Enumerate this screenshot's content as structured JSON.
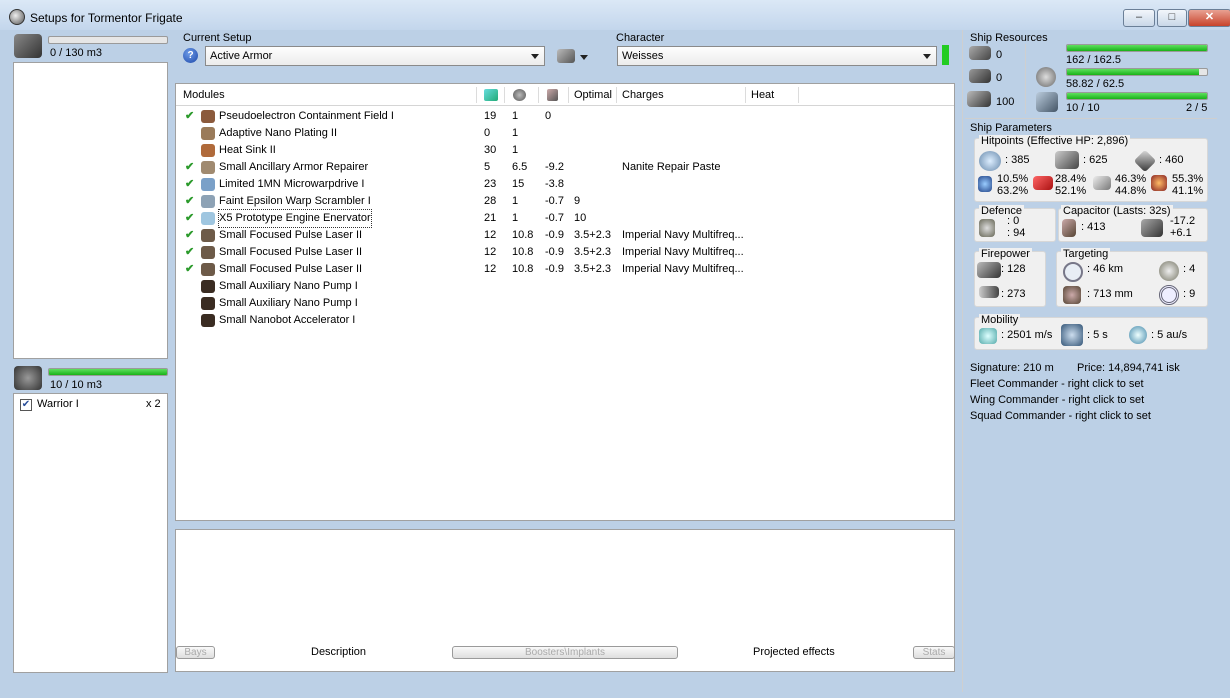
{
  "window": {
    "title": "Setups for Tormentor Frigate",
    "minimize": "–",
    "maximize": "□",
    "close": "✕"
  },
  "cargo": {
    "capacity": "0 / 130 m3",
    "fill": 0
  },
  "drones": {
    "capacity": "10 / 10 m3",
    "fill": 1.0,
    "items": [
      {
        "name": "Warrior I",
        "count": "x 2",
        "checked": true
      }
    ]
  },
  "setup": {
    "label": "Current Setup",
    "value": "Active Armor",
    "help_icon": "question-icon"
  },
  "character": {
    "label": "Character",
    "value": "Weisses"
  },
  "modules": {
    "headers": {
      "name": "Modules",
      "optimal": "Optimal",
      "charges": "Charges",
      "heat": "Heat"
    },
    "rows": [
      {
        "check": "✔",
        "name": "Pseudoelectron Containment Field I",
        "cpu": "19",
        "pg": "1",
        "cap": "0",
        "optimal": "",
        "charge": "",
        "color": "#8b5a3c"
      },
      {
        "check": "",
        "name": "Adaptive Nano Plating II",
        "cpu": "0",
        "pg": "1",
        "cap": "",
        "optimal": "",
        "charge": "",
        "color": "#9a7b5a"
      },
      {
        "check": "",
        "name": "Heat Sink II",
        "cpu": "30",
        "pg": "1",
        "cap": "",
        "optimal": "",
        "charge": "",
        "color": "#b06a3a"
      },
      {
        "check": "✔",
        "name": "Small Ancillary Armor Repairer",
        "cpu": "5",
        "pg": "6.5",
        "cap": "-9.2",
        "optimal": "",
        "charge": "Nanite Repair Paste",
        "color": "#a08a70"
      },
      {
        "check": "✔",
        "name": "Limited 1MN Microwarpdrive I",
        "cpu": "23",
        "pg": "15",
        "cap": "-3.8",
        "optimal": "",
        "charge": "",
        "color": "#7aa0c8"
      },
      {
        "check": "✔",
        "name": "Faint Epsilon Warp Scrambler I",
        "cpu": "28",
        "pg": "1",
        "cap": "-0.7",
        "optimal": "9",
        "charge": "",
        "color": "#8da2b5"
      },
      {
        "check": "✔",
        "name": "X5 Prototype Engine Enervator",
        "cpu": "21",
        "pg": "1",
        "cap": "-0.7",
        "optimal": "10",
        "charge": "",
        "color": "#9fc6e0"
      },
      {
        "check": "✔",
        "name": "Small Focused Pulse Laser II",
        "cpu": "12",
        "pg": "10.8",
        "cap": "-0.9",
        "optimal": "3.5+2.3",
        "charge": "Imperial Navy Multifreq...",
        "color": "#6d5a48"
      },
      {
        "check": "✔",
        "name": "Small Focused Pulse Laser II",
        "cpu": "12",
        "pg": "10.8",
        "cap": "-0.9",
        "optimal": "3.5+2.3",
        "charge": "Imperial Navy Multifreq...",
        "color": "#6d5a48"
      },
      {
        "check": "✔",
        "name": "Small Focused Pulse Laser II",
        "cpu": "12",
        "pg": "10.8",
        "cap": "-0.9",
        "optimal": "3.5+2.3",
        "charge": "Imperial Navy Multifreq...",
        "color": "#6d5a48"
      },
      {
        "check": "",
        "name": "Small Auxiliary Nano Pump I",
        "cpu": "",
        "pg": "",
        "cap": "",
        "optimal": "",
        "charge": "",
        "color": "#3a2c22"
      },
      {
        "check": "",
        "name": "Small Auxiliary Nano Pump I",
        "cpu": "",
        "pg": "",
        "cap": "",
        "optimal": "",
        "charge": "",
        "color": "#3a2c22"
      },
      {
        "check": "",
        "name": "Small Nanobot Accelerator I",
        "cpu": "",
        "pg": "",
        "cap": "",
        "optimal": "",
        "charge": "",
        "color": "#3a2c22"
      }
    ]
  },
  "tabs": {
    "bays": "Bays",
    "description": "Description",
    "boosters": "Boosters\\Implants",
    "projected": "Projected effects",
    "stats": "Stats"
  },
  "resources": {
    "label": "Ship Resources",
    "hardpoints": [
      "0",
      "0",
      "100"
    ],
    "cpu": {
      "text": "162 / 162.5",
      "fill": 0.997
    },
    "power": {
      "text": "58.82 / 62.5",
      "fill": 0.94
    },
    "calibration": {
      "text": "10 / 10",
      "fill": 1.0
    },
    "rigs": "2 / 5"
  },
  "params": {
    "label": "Ship Parameters",
    "hp_label": "Hitpoints (Effective HP: 2,896)",
    "shield": ": 385",
    "armor": ": 625",
    "structure": ": 460",
    "resists": [
      {
        "top": "10.5%",
        "bottom": "63.2%"
      },
      {
        "top": "28.4%",
        "bottom": "52.1%"
      },
      {
        "top": "46.3%",
        "bottom": "44.8%"
      },
      {
        "top": "55.3%",
        "bottom": "41.1%"
      }
    ],
    "defence": {
      "label": "Defence",
      "top": ": 0",
      "bottom": ": 94"
    },
    "capacitor": {
      "label": "Capacitor (Lasts: 32s)",
      "amount": ": 413",
      "top": "-17.2",
      "bottom": "+6.1"
    },
    "firepower": {
      "label": "Firepower",
      "dps": ": 128",
      "volley": ": 273"
    },
    "targeting": {
      "label": "Targeting",
      "range": ": 46 km",
      "targets": ": 4",
      "resolution": ": 713 mm",
      "sensor": ": 9"
    },
    "mobility": {
      "label": "Mobility",
      "speed": ": 2501 m/s",
      "align": ": 5 s",
      "warp": ": 5 au/s"
    },
    "signature": "Signature: 210 m",
    "price": "Price: 14,894,741 isk",
    "fleet": "Fleet Commander - right click to set",
    "wing": "Wing Commander - right click to set",
    "squad": "Squad Commander - right click to set"
  },
  "colors": {
    "bar_green": "#22bb22",
    "check_green": "#2b9a2b",
    "title_bg": "#c9dbef"
  }
}
